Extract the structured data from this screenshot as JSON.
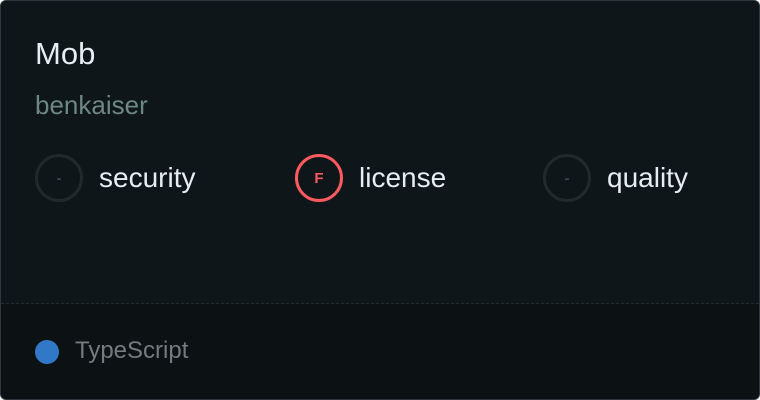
{
  "repo": {
    "name": "Mob",
    "owner": "benkaiser"
  },
  "metrics": [
    {
      "grade": "-",
      "label": "security"
    },
    {
      "grade": "F",
      "label": "license",
      "status_color": "#ff5a5f"
    },
    {
      "grade": "-",
      "label": "quality"
    }
  ],
  "language": {
    "name": "TypeScript",
    "color": "#3178c6"
  }
}
